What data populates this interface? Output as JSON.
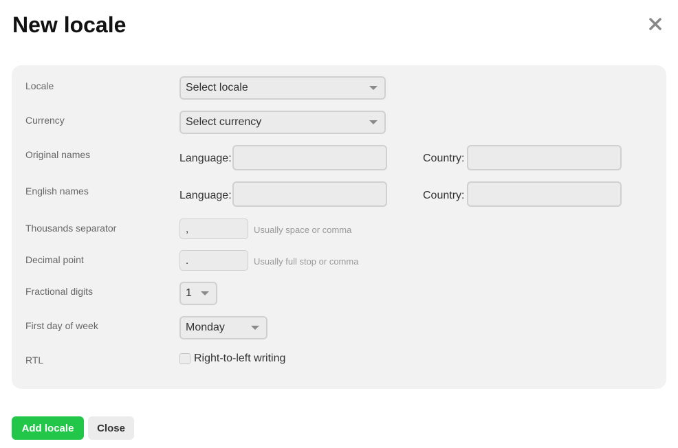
{
  "dialog": {
    "title": "New locale",
    "close_icon": "close-icon"
  },
  "form": {
    "locale": {
      "label": "Locale",
      "value": "Select locale"
    },
    "currency": {
      "label": "Currency",
      "value": "Select currency"
    },
    "original_names": {
      "label": "Original names",
      "language_label": "Language:",
      "language_value": "",
      "country_label": "Country:",
      "country_value": ""
    },
    "english_names": {
      "label": "English names",
      "language_label": "Language:",
      "language_value": "",
      "country_label": "Country:",
      "country_value": ""
    },
    "thousands_separator": {
      "label": "Thousands separator",
      "value": ",",
      "hint": "Usually space or comma"
    },
    "decimal_point": {
      "label": "Decimal point",
      "value": ".",
      "hint": "Usually full stop or comma"
    },
    "fractional_digits": {
      "label": "Fractional digits",
      "value": "1"
    },
    "first_day_of_week": {
      "label": "First day of week",
      "value": "Monday"
    },
    "rtl": {
      "label": "RTL",
      "checkbox_label": "Right-to-left writing",
      "checked": false
    }
  },
  "actions": {
    "add_label": "Add locale",
    "close_label": "Close"
  },
  "colors": {
    "primary": "#22c74a",
    "panel": "#f2f2f2"
  }
}
